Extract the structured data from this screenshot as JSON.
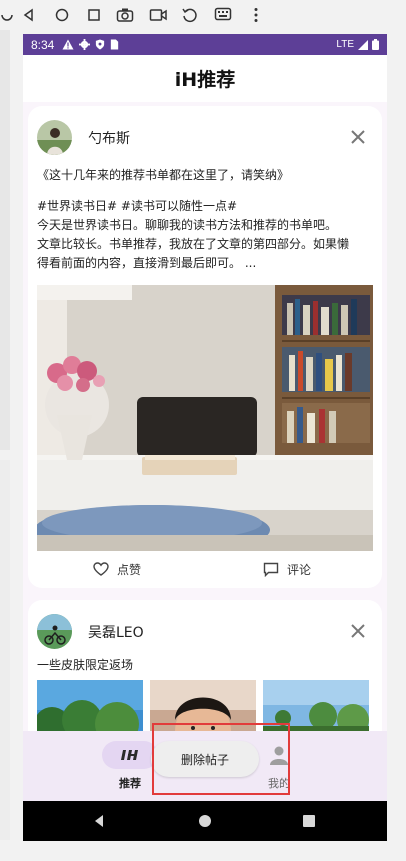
{
  "emulator": {
    "tool_icons": [
      "power-icon",
      "back-icon",
      "home-icon",
      "overview-icon",
      "camera-icon",
      "video-icon",
      "rotate-icon",
      "keyboard-icon",
      "more-icon"
    ]
  },
  "status_bar": {
    "time": "8:34",
    "network": "LTE",
    "icons": [
      "warning-icon",
      "settings-icon",
      "shield-icon",
      "sim-icon"
    ]
  },
  "app": {
    "title": "iH推荐"
  },
  "posts": [
    {
      "author": "勺布斯",
      "title": "《这十几年来的推荐书单都在这里了，请笑纳》",
      "body_lines": [
        "#世界读书日# #读书可以随性一点#",
        "今天是世界读书日。聊聊我的读书方法和推荐的书单吧。",
        "文章比较长。书单推荐，我放在了文章的第四部分。如果懒",
        "得看前面的内容，直接滑到最后即可。 ..."
      ],
      "like_label": "点赞",
      "comment_label": "评论"
    },
    {
      "author": "吴磊LEO",
      "text": "一些皮肤限定返场"
    }
  ],
  "bottom_nav": {
    "items": [
      {
        "label": "推荐",
        "icon": "ih-logo-icon",
        "active": true
      },
      {
        "label": "我的",
        "icon": "profile-icon",
        "active": false
      }
    ]
  },
  "toast": {
    "text": "删除帖子"
  },
  "colors": {
    "status_bar": "#5d3f97",
    "nav_background": "#f1e9f6",
    "nav_active_pill": "#e4d6f2",
    "highlight": "#e23b3b"
  }
}
